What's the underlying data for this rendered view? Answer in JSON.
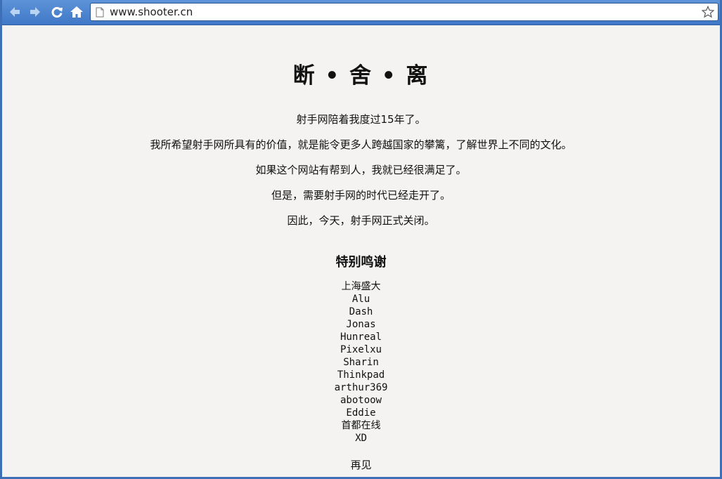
{
  "browser": {
    "address": "www.shooter.cn",
    "icons": {
      "back": "back-arrow-icon",
      "forward": "forward-arrow-icon",
      "reload": "reload-icon",
      "home": "home-icon",
      "page": "page-icon",
      "bookmark": "star-icon"
    },
    "colors": {
      "toolbar": "#4a85d0",
      "page_background": "#f4f3f2"
    }
  },
  "page": {
    "title": "断 • 舍 • 离",
    "paragraphs": [
      "射手网陪着我度过15年了。",
      "我所希望射手网所具有的价值，就是能令更多人跨越国家的攀篱，了解世界上不同的文化。",
      "如果这个网站有帮到人，我就已经很满足了。",
      "但是，需要射手网的时代已经走开了。",
      "因此，今天，射手网正式关闭。"
    ],
    "thanks_title": "特别鸣谢",
    "thanks": [
      "上海盛大",
      "Alu",
      "Dash",
      "Jonas",
      "Hunreal",
      "Pixelxu",
      "Sharin",
      "Thinkpad",
      "arthur369",
      "abotoow",
      "Eddie",
      "首都在线",
      "XD"
    ],
    "goodbye": "再见"
  }
}
